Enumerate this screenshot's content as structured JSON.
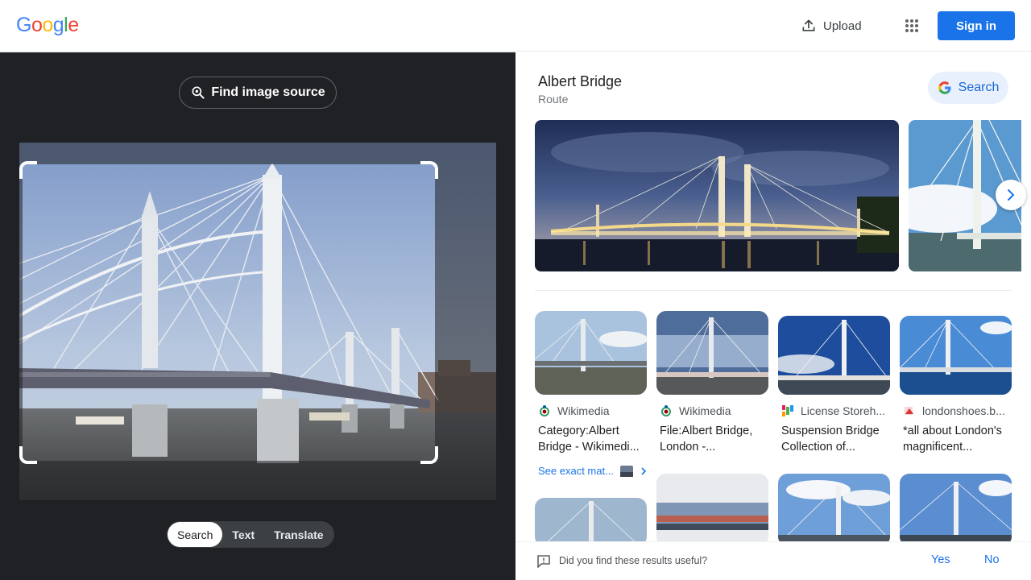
{
  "header": {
    "logo_letters": [
      "G",
      "o",
      "o",
      "g",
      "l",
      "e"
    ],
    "upload_label": "Upload",
    "signin_label": "Sign in"
  },
  "lens": {
    "find_source_label": "Find image source",
    "modes": [
      {
        "label": "Search",
        "active": true
      },
      {
        "label": "Text",
        "active": false
      },
      {
        "label": "Translate",
        "active": false
      }
    ]
  },
  "entity": {
    "title": "Albert Bridge",
    "subtitle": "Route",
    "search_label": "Search"
  },
  "results": [
    {
      "source": "Wikimedia",
      "title": "Category:Albert Bridge - Wikimedi...",
      "favicon": "wikimedia-icon"
    },
    {
      "source": "Wikimedia",
      "title": "File:Albert Bridge, London -...",
      "favicon": "wikimedia-icon"
    },
    {
      "source": "License Storeh...",
      "title": "Suspension Bridge Collection of...",
      "favicon": "license-storehouse-icon"
    },
    {
      "source": "londonshoes.b...",
      "title": "*all about London's magnificent...",
      "favicon": "londonshoes-icon"
    }
  ],
  "see_exact_matches": "See exact mat...",
  "feedback": {
    "question": "Did you find these results useful?",
    "yes": "Yes",
    "no": "No"
  },
  "colors": {
    "primary_blue": "#1a73e8",
    "dark_pane": "#202124",
    "search_chip_bg": "#e8f0fe"
  }
}
